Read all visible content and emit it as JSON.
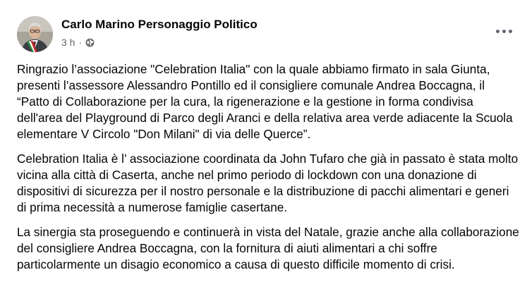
{
  "post": {
    "author": "Carlo Marino Personaggio Politico",
    "time": "3 h",
    "separator": "·",
    "privacy_icon": "globe-icon",
    "more_icon": "more-options-icon",
    "paragraphs": [
      "Ringrazio l’associazione \"Celebration Italia\" con la quale abbiamo firmato in sala Giunta, presenti l’assessore Alessandro Pontillo ed il consigliere comunale Andrea Boccagna, il “Patto di Collaborazione per la cura, la rigenerazione e la gestione in forma condivisa dell'area del Playground di Parco degli Aranci e della relativa area verde adiacente la Scuola elementare V Circolo \"Don Milani\" di via delle Querce”.",
      "Celebration Italia è l’ associazione coordinata da John Tufaro che già in passato è stata molto vicina alla città di Caserta, anche nel primo periodo di lockdown con una donazione di dispositivi di sicurezza per il nostro personale e la distribuzione di pacchi alimentari e generi di prima necessità a numerose famiglie casertane.",
      "La sinergia sta proseguendo e continuerà in vista del Natale, grazie anche alla collaborazione del consigliere Andrea Boccagna, con la fornitura di aiuti alimentari a chi soffre particolarmente un disagio economico a causa di questo difficile momento di crisi."
    ]
  },
  "colors": {
    "text": "#050505",
    "secondary_text": "#65676b",
    "background": "#ffffff",
    "more_dots": "#606770"
  }
}
